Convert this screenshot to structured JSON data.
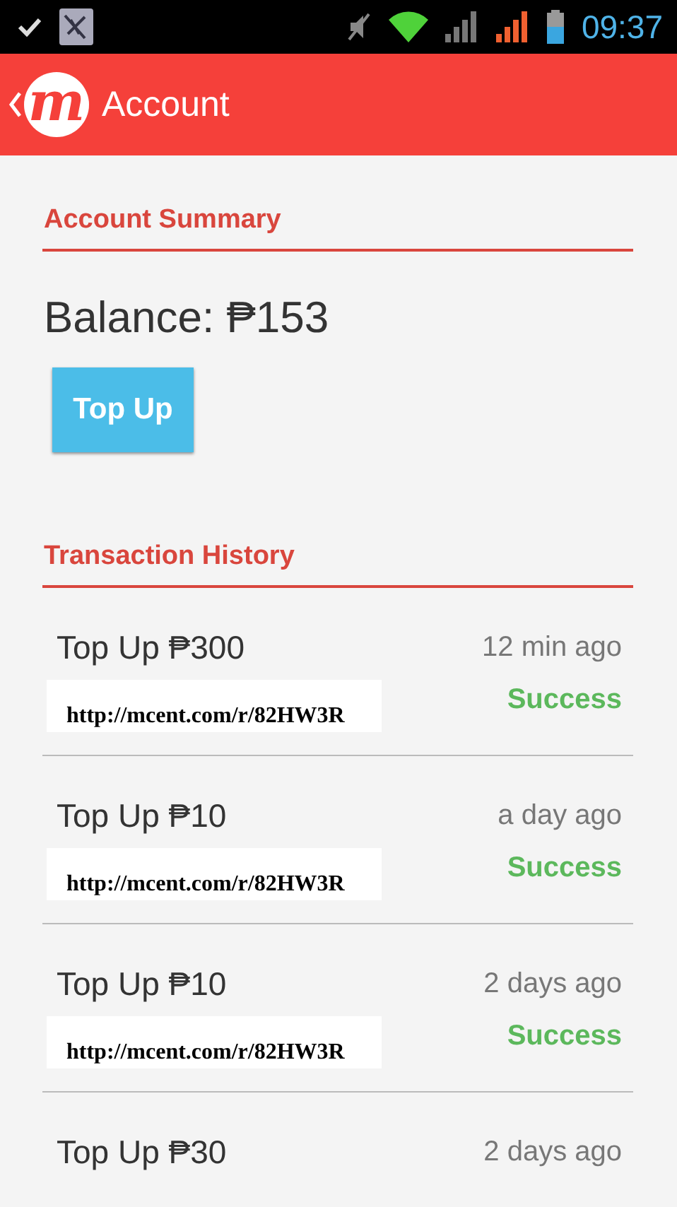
{
  "status_bar": {
    "time": "09:37"
  },
  "app_bar": {
    "logo_letter": "m",
    "title": "Account"
  },
  "summary": {
    "heading": "Account Summary",
    "balance": "Balance: ₱153",
    "button": "Top Up"
  },
  "history": {
    "heading": "Transaction History",
    "rows": [
      {
        "title": "Top Up ₱300",
        "time": "12 min ago",
        "link": "http://mcent.com/r/82HW3R",
        "status": "Success"
      },
      {
        "title": "Top Up ₱10",
        "time": "a day ago",
        "link": "http://mcent.com/r/82HW3R",
        "status": "Success"
      },
      {
        "title": "Top Up ₱10",
        "time": "2 days ago",
        "link": "http://mcent.com/r/82HW3R",
        "status": "Success"
      },
      {
        "title": "Top Up ₱30",
        "time": "2 days ago"
      }
    ]
  }
}
